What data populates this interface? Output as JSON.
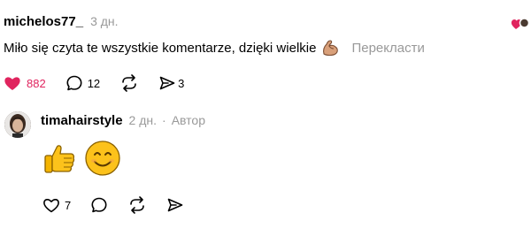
{
  "comment": {
    "username": "michelos77_",
    "time": "3 дн.",
    "text": "Miło się czyta te wszystkie komentarze, dzięki wielkie",
    "emoji": "💪",
    "translate_label": "Перекласти",
    "likes": "882",
    "replies": "12",
    "reposts": "",
    "shares": "3",
    "liked": true,
    "like_color": "#e0245e"
  },
  "reply": {
    "username": "timahairstyle",
    "time": "2 дн.",
    "separator": "·",
    "author_label": "Автор",
    "emojis": [
      "👍",
      "😊"
    ],
    "likes": "7",
    "replies": "",
    "reposts": "",
    "shares": ""
  },
  "icons": {
    "like": "heart-icon",
    "reply": "comment-bubble-icon",
    "repost": "repost-arrows-icon",
    "share": "send-arrow-icon",
    "liked_by_author": "heart-with-avatar-icon"
  }
}
